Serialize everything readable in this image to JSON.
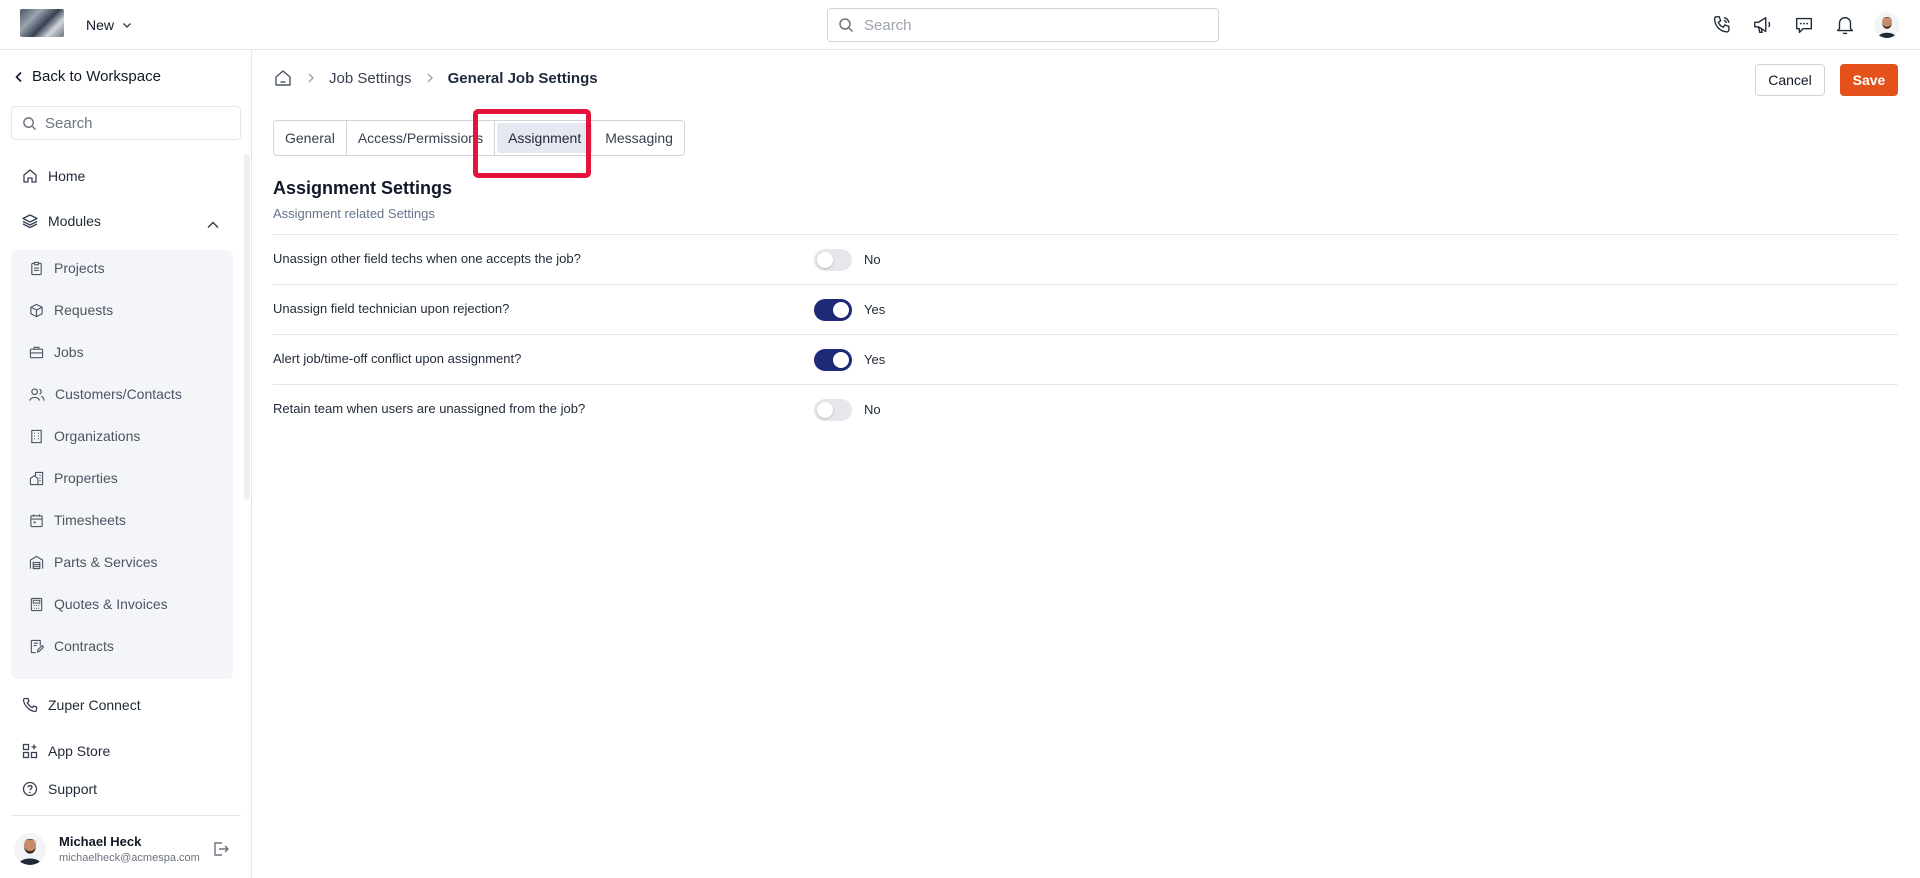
{
  "topbar": {
    "new_label": "New",
    "search_placeholder": "Search"
  },
  "sidebar": {
    "back_label": "Back to Workspace",
    "search_placeholder": "Search",
    "home_label": "Home",
    "modules_label": "Modules",
    "modules": [
      {
        "label": "Projects",
        "icon": "clipboard-icon"
      },
      {
        "label": "Requests",
        "icon": "box-icon"
      },
      {
        "label": "Jobs",
        "icon": "briefcase-icon"
      },
      {
        "label": "Customers/Contacts",
        "icon": "users-icon"
      },
      {
        "label": "Organizations",
        "icon": "building-icon"
      },
      {
        "label": "Properties",
        "icon": "property-icon"
      },
      {
        "label": "Timesheets",
        "icon": "calendar-icon"
      },
      {
        "label": "Parts & Services",
        "icon": "warehouse-icon"
      },
      {
        "label": "Quotes & Invoices",
        "icon": "calculator-icon"
      },
      {
        "label": "Contracts",
        "icon": "contract-icon"
      }
    ],
    "bottom_items": [
      {
        "label": "Zuper Connect",
        "icon": "phone-icon"
      },
      {
        "label": "App Store",
        "icon": "apps-icon"
      },
      {
        "label": "Support",
        "icon": "help-icon"
      }
    ],
    "user": {
      "name": "Michael Heck",
      "email": "michaelheck@acmespa.com"
    }
  },
  "breadcrumb": {
    "parent": "Job Settings",
    "current": "General Job Settings"
  },
  "actions": {
    "cancel_label": "Cancel",
    "save_label": "Save"
  },
  "tabs": [
    {
      "label": "General",
      "active": false
    },
    {
      "label": "Access/Permissions",
      "active": false
    },
    {
      "label": "Assignment",
      "active": true
    },
    {
      "label": "Messaging",
      "active": false
    }
  ],
  "section": {
    "title": "Assignment Settings",
    "subtitle": "Assignment related Settings"
  },
  "settings": [
    {
      "label": "Unassign other field techs when one accepts the job?",
      "enabled": false,
      "state_text": "No"
    },
    {
      "label": "Unassign field technician upon rejection?",
      "enabled": true,
      "state_text": "Yes"
    },
    {
      "label": "Alert job/time-off conflict upon assignment?",
      "enabled": true,
      "state_text": "Yes"
    },
    {
      "label": "Retain team when users are unassigned from the job?",
      "enabled": false,
      "state_text": "No"
    }
  ],
  "colors": {
    "accent_save": "#e4511b",
    "toggle_on": "#1e2a78",
    "highlight": "#e4133b"
  }
}
